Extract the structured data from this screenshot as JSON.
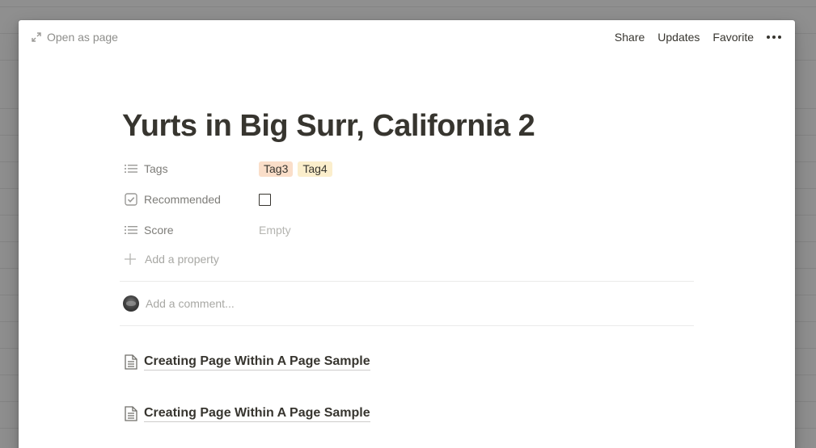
{
  "topbar": {
    "open_as_page": "Open as page",
    "share": "Share",
    "updates": "Updates",
    "favorite": "Favorite",
    "more_icon": "ellipsis-icon"
  },
  "page": {
    "title": "Yurts in Big Surr, California 2"
  },
  "properties": {
    "tags": {
      "label": "Tags",
      "icon": "list-icon",
      "values": [
        {
          "text": "Tag3",
          "color": "#fadec9"
        },
        {
          "text": "Tag4",
          "color": "#fbeecc"
        }
      ]
    },
    "recommended": {
      "label": "Recommended",
      "icon": "checkbox-icon",
      "checked": false
    },
    "score": {
      "label": "Score",
      "icon": "list-icon",
      "value": "Empty"
    },
    "add_property": "Add a property"
  },
  "comment": {
    "placeholder": "Add a comment..."
  },
  "links": [
    {
      "text": "Creating Page Within A Page Sample"
    },
    {
      "text": "Creating Page Within A Page Sample"
    }
  ]
}
